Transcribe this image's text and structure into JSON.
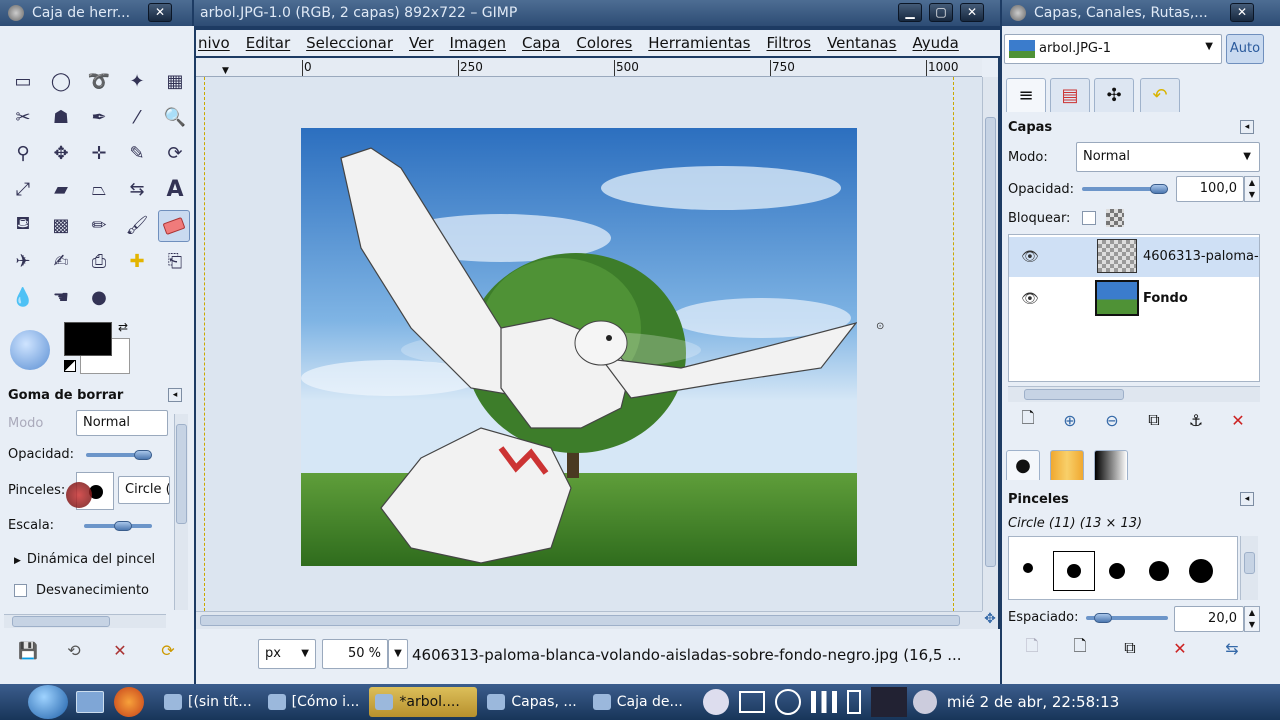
{
  "toolbox": {
    "title": "Caja de herr...",
    "tool_options_title": "Goma de borrar",
    "mode_label": "Modo",
    "mode_value": "Normal",
    "opacity_label": "Opacidad:",
    "brushes_label": "Pinceles:",
    "brush_value": "Circle (",
    "scale_label": "Escala:",
    "dynamics_label": "Dinámica del pincel",
    "fade_label": "Desvanecimiento"
  },
  "image_window": {
    "title": "arbol.JPG-1.0 (RGB, 2 capas) 892x722 – GIMP",
    "menu": [
      "nivo",
      "Editar",
      "Seleccionar",
      "Ver",
      "Imagen",
      "Capa",
      "Colores",
      "Herramientas",
      "Filtros",
      "Ventanas",
      "Ayuda"
    ],
    "ruler_labels": [
      "0",
      "250",
      "500",
      "750",
      "1000"
    ],
    "unit": "px",
    "zoom": "50 %",
    "status_text": "4606313-paloma-blanca-volando-aisladas-sobre-fondo-negro.jpg (16,5 ..."
  },
  "layers_dock": {
    "title": "Capas, Canales, Rutas,...",
    "image_selector": "arbol.JPG-1",
    "auto_button": "Auto",
    "layers_title": "Capas",
    "mode_label": "Modo:",
    "mode_value": "Normal",
    "opacity_label": "Opacidad:",
    "opacity_value": "100,0",
    "lock_label": "Bloquear:",
    "layers": [
      {
        "name": "4606313-paloma-"
      },
      {
        "name": "Fondo"
      }
    ],
    "brushes_title": "Pinceles",
    "brush_name": "Circle (11) (13 × 13)",
    "spacing_label": "Espaciado:",
    "spacing_value": "20,0"
  },
  "taskbar": {
    "tasks": [
      {
        "label": "[(sin tít..."
      },
      {
        "label": "[Cómo i..."
      },
      {
        "label": "*arbol...."
      },
      {
        "label": "Capas, ..."
      },
      {
        "label": "Caja de..."
      }
    ],
    "clock": "mié  2 de abr, 22:58:13"
  },
  "colors": {
    "titlebar": "#3a5a82",
    "panel": "#e8eef6",
    "accent": "#6c95c9",
    "active_task": "#dcbf5a"
  }
}
